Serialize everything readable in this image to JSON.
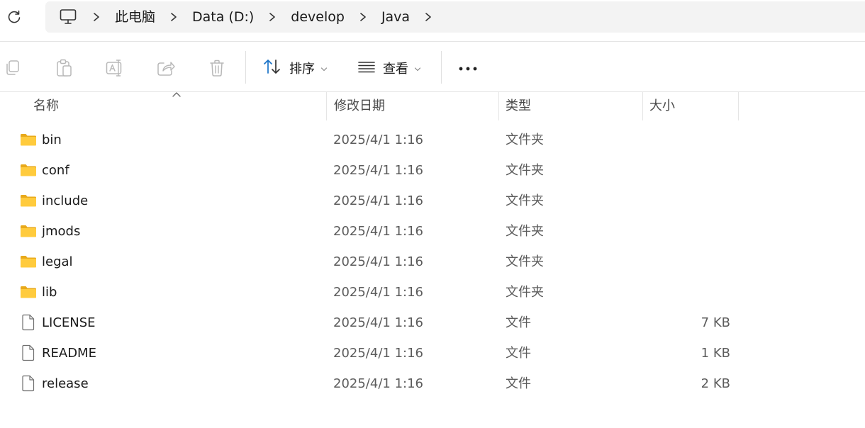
{
  "address_bar": {
    "refresh_icon": "refresh-icon",
    "computer_icon": "computer-icon",
    "separator_icon": "chevron-right-icon",
    "breadcrumbs": [
      "此电脑",
      "Data (D:)",
      "develop",
      "Java"
    ]
  },
  "command_bar": {
    "icons": [
      "copy-icon",
      "paste-icon",
      "rename-icon",
      "share-icon",
      "delete-icon"
    ],
    "sort_label": "排序",
    "view_label": "查看",
    "more_icon": "more-icon"
  },
  "columns": {
    "name": "名称",
    "date": "修改日期",
    "type": "类型",
    "size": "大小"
  },
  "files": [
    {
      "name": "bin",
      "date": "2025/4/1 1:16",
      "type": "文件夹",
      "size": "",
      "kind": "folder"
    },
    {
      "name": "conf",
      "date": "2025/4/1 1:16",
      "type": "文件夹",
      "size": "",
      "kind": "folder"
    },
    {
      "name": "include",
      "date": "2025/4/1 1:16",
      "type": "文件夹",
      "size": "",
      "kind": "folder"
    },
    {
      "name": "jmods",
      "date": "2025/4/1 1:16",
      "type": "文件夹",
      "size": "",
      "kind": "folder"
    },
    {
      "name": "legal",
      "date": "2025/4/1 1:16",
      "type": "文件夹",
      "size": "",
      "kind": "folder"
    },
    {
      "name": "lib",
      "date": "2025/4/1 1:16",
      "type": "文件夹",
      "size": "",
      "kind": "folder"
    },
    {
      "name": "LICENSE",
      "date": "2025/4/1 1:16",
      "type": "文件",
      "size": "7 KB",
      "kind": "file"
    },
    {
      "name": "README",
      "date": "2025/4/1 1:16",
      "type": "文件",
      "size": "1 KB",
      "kind": "file"
    },
    {
      "name": "release",
      "date": "2025/4/1 1:16",
      "type": "文件",
      "size": "2 KB",
      "kind": "file"
    }
  ],
  "colors": {
    "folder_yellow": "#FFCB3D",
    "folder_dark": "#E8A91B",
    "accent_blue": "#1A73C8"
  }
}
